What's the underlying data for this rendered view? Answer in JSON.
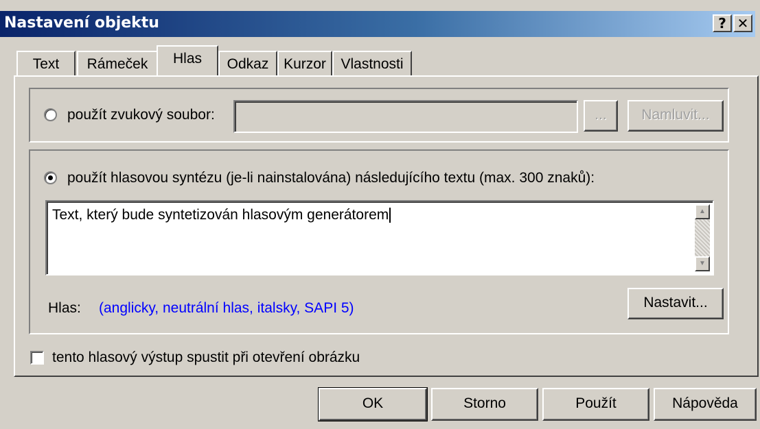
{
  "window": {
    "title": "Nastavení objektu",
    "help_button": "?",
    "close_button": "✕"
  },
  "tabs": [
    {
      "label": "Text",
      "active": false
    },
    {
      "label": "Rámeček",
      "active": false
    },
    {
      "label": "Hlas",
      "active": true
    },
    {
      "label": "Odkaz",
      "active": false
    },
    {
      "label": "Kurzor",
      "active": false
    },
    {
      "label": "Vlastnosti",
      "active": false
    }
  ],
  "sound_file": {
    "radio_label": "použít zvukový soubor:",
    "selected": false,
    "path_value": "",
    "browse_label": "...",
    "record_label": "Namluvit...",
    "record_enabled": false
  },
  "synthesis": {
    "radio_label": "použít hlasovou syntézu (je-li nainstalována) následujícího textu (max. 300 znaků):",
    "selected": true,
    "text_value": "Text, který bude syntetizován hlasovým generátorem",
    "voice_label": "Hlas:",
    "voice_value": "(anglicky, neutrální hlas, italsky, SAPI 5)",
    "settings_label": "Nastavit...",
    "voice_color": "#0000ff"
  },
  "autoplay": {
    "label": "tento hlasový výstup spustit při otevření obrázku",
    "checked": false
  },
  "buttons": {
    "ok": "OK",
    "cancel": "Storno",
    "apply": "Použít",
    "help": "Nápověda"
  }
}
